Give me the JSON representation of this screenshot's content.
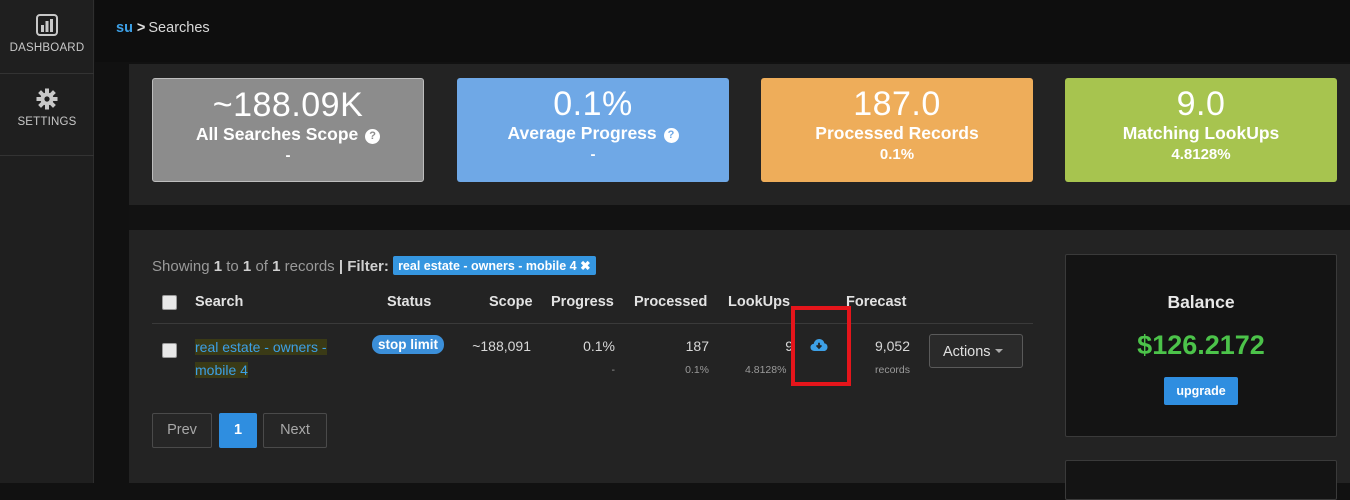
{
  "sidebar": {
    "items": [
      {
        "label": "DASHBOARD",
        "icon": "bar-chart-icon"
      },
      {
        "label": "SETTINGS",
        "icon": "gear-icon"
      }
    ]
  },
  "breadcrumb": {
    "root": "su",
    "separator": ">",
    "current": "Searches"
  },
  "stats": [
    {
      "value": "~188.09K",
      "label": "All Searches Scope",
      "sub": "-",
      "color": "#8c8c8c"
    },
    {
      "value": "0.1%",
      "label": "Average Progress",
      "sub": "-",
      "color": "#6fa8e6"
    },
    {
      "value": "187.0",
      "label": "Processed Records",
      "sub": "0.1%",
      "color": "#eead5a"
    },
    {
      "value": "9.0",
      "label": "Matching LookUps",
      "sub": "4.8128%",
      "color": "#a7c44f"
    }
  ],
  "table_info": {
    "showing": "Showing",
    "from": "1",
    "to_word": "to",
    "to": "1",
    "of_word": "of",
    "total": "1",
    "records_word": "records",
    "divider": "|",
    "filter_label": "Filter:",
    "filter_value": "real estate - owners - mobile 4",
    "filter_remove": "✖"
  },
  "table": {
    "headers": {
      "search": "Search",
      "status": "Status",
      "scope": "Scope",
      "progress": "Progress",
      "processed": "Processed",
      "lookups": "LookUps",
      "forecast": "Forecast"
    },
    "rows": [
      {
        "search": "real estate - owners - mobile 4",
        "search_line1": "real estate - owners -",
        "search_line2": "mobile 4",
        "status": "stop limit",
        "scope": "~188,091",
        "progress": "0.1%",
        "progress_sub": "-",
        "processed": "187",
        "processed_sub": "0.1%",
        "lookups": "9",
        "lookups_sub": "4.8128%",
        "forecast": "9,052",
        "forecast_sub": "records",
        "actions_label": "Actions"
      }
    ]
  },
  "pagination": {
    "prev": "Prev",
    "current": "1",
    "next": "Next"
  },
  "balance": {
    "title": "Balance",
    "amount": "$126.2172",
    "upgrade_label": "upgrade"
  },
  "colors": {
    "accent": "#3da0e6",
    "highlight": "#e5151b",
    "balance": "#4cc34a"
  }
}
